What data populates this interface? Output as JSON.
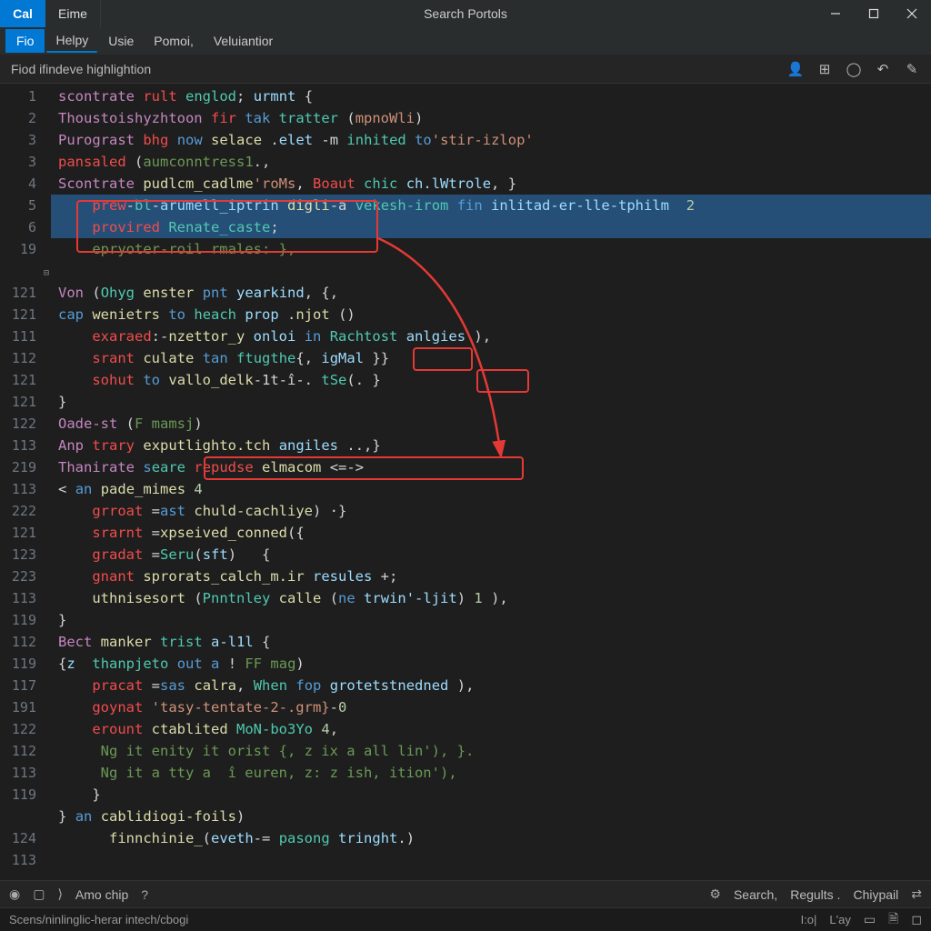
{
  "titlebar": {
    "app_badge": "Cal",
    "tab": "Eime",
    "title": "Search Portols"
  },
  "menubar": {
    "items": [
      "Fio",
      "Helpy",
      "Usie",
      "Pomoi,",
      "Veluiantior"
    ]
  },
  "subbar": {
    "label": "Fiod ifindeve highlightion"
  },
  "gutter_lines": [
    "1",
    "2",
    "3",
    "3",
    "4",
    "5",
    "6",
    "19",
    "",
    "121",
    "121",
    "111",
    "112",
    "121",
    "121",
    "122",
    "113",
    "219",
    "113",
    "222",
    "121",
    "123",
    "223",
    "113",
    "119",
    "112",
    "119",
    "117",
    "191",
    "122",
    "112",
    "113",
    "119",
    "",
    "124",
    "113"
  ],
  "code_lines": [
    {
      "cls": "",
      "html": "<span class='kw'>scontrate</span> <span class='err'>rult</span> <span class='ty'>englod</span><span class='op'>;</span> <span class='prop'>urmnt</span> <span class='op'>{</span>"
    },
    {
      "cls": "",
      "html": "<span class='kw'>Thoustoishyzhtoon</span> <span class='err'>fir</span> <span class='blue'>tak</span> <span class='ty'>tratter</span> <span class='op'>(</span><span class='str'>mpnoWli</span><span class='op'>)</span>"
    },
    {
      "cls": "",
      "html": "<span class='kw'>Purograst</span> <span class='err'>bhg</span> <span class='blue'>now</span> <span class='fn'>selace</span> <span class='op'>.</span><span class='prop'>elet</span> <span class='op'>-m</span> <span class='ty'>inhited</span> <span class='blue'>to</span><span class='str'>'stir-izlop'</span>"
    },
    {
      "cls": "",
      "html": "<span class='err'>pansaled</span> <span class='op'>(</span><span class='cm'>aumconntress1</span><span class='op'>.,</span>"
    },
    {
      "cls": "",
      "html": "<span class='kw'>Scontrate</span> <span class='fn'>pudlcm_cadlme</span><span class='str'>'roMs</span><span class='op'>,</span> <span class='err'>Boaut</span> <span class='ty'>chic</span> <span class='prop'>ch.lWtrole</span><span class='op'>, }</span>"
    },
    {
      "cls": "sel",
      "html": "    <span class='err'>prew</span><span class='op'>-</span><span class='ty'>bl</span><span class='op'>-</span><span class='prop'>arumell_iptrin</span> <span class='fn'>digli</span><span class='op'>-a</span> <span class='ty'>vekesh-irom</span> <span class='blue'>fin</span> <span class='prop'>inlitad-er-lle-tphilm</span>  <span class='num'>2</span>"
    },
    {
      "cls": "sel",
      "html": "    <span class='err'>provired</span> <span class='ty'>Renate_caste</span><span class='op'>;</span>"
    },
    {
      "cls": "",
      "html": "    <span class='cm'>epryoter-roil rmales: },</span>"
    },
    {
      "cls": "",
      "html": ""
    },
    {
      "cls": "",
      "html": "<span class='kw'>Von</span> <span class='op'>(</span><span class='ty'>Ohyg</span> <span class='fn'>enster</span> <span class='blue'>pnt</span> <span class='prop'>yearkind</span><span class='op'>, {,</span>"
    },
    {
      "cls": "",
      "html": "<span class='blue'>cap</span> <span class='fn'>wenietrs</span> <span class='blue'>to</span> <span class='ty'>heach</span> <span class='prop'>prop</span> <span class='op'>.</span><span class='fn'>njot</span> <span class='op'>()</span>"
    },
    {
      "cls": "",
      "html": "    <span class='err'>exaraed</span><span class='op'>:-</span><span class='fn'>nzettor_y</span> <span class='prop'>onloi</span> <span class='blue'>in</span> <span class='ty'>Rachtost</span> <span class='prop'>anlgies</span> <span class='op'>),</span>"
    },
    {
      "cls": "",
      "html": "    <span class='err'>srant</span> <span class='fn'>culate</span> <span class='blue'>tan</span> <span class='ty'>ftugthe</span><span class='op'>{,</span> <span class='prop'>igMal</span> <span class='op'>}}</span>"
    },
    {
      "cls": "",
      "html": "    <span class='err'>sohut</span> <span class='blue'>to</span> <span class='fn'>vallo_delk</span><span class='op'>-1t-î-.</span> <span class='ty'>tSe</span><span class='op'>(. }</span>"
    },
    {
      "cls": "",
      "html": "<span class='op'>}</span>"
    },
    {
      "cls": "",
      "html": "<span class='kw'>Oade-st</span> <span class='op'>(</span><span class='cm'>F mamsj</span><span class='op'>)</span>"
    },
    {
      "cls": "",
      "html": "<span class='kw'>Anp</span> <span class='err'>trary</span> <span class='fn'>exputlighto.tch</span> <span class='prop'>angiles</span> <span class='op'>..,}</span>"
    },
    {
      "cls": "",
      "html": "<span class='kw'>Thanirate</span> <span class='blue'>s</span><span class='ty'>eare</span> <span class='err'>repudse</span> <span class='fn'>elmacom</span> <span class='op'>&lt;=-&gt;</span>"
    },
    {
      "cls": "",
      "html": "<span class='op'>&lt;</span> <span class='blue'>an</span> <span class='fn'>pade_mimes</span> <span class='num'>4</span>"
    },
    {
      "cls": "",
      "html": "    <span class='err'>grroat</span> <span class='op'>=</span><span class='blue'>ast</span> <span class='fn'>chuld-cachliye</span><span class='op'>) ·}</span>"
    },
    {
      "cls": "",
      "html": "    <span class='err'>srarnt</span> <span class='op'>=</span><span class='fn'>xpseived_conned</span><span class='op'>({</span>"
    },
    {
      "cls": "",
      "html": "    <span class='err'>gradat</span> <span class='op'>=</span><span class='ty'>Seru</span><span class='op'>(</span><span class='prop'>sft</span><span class='op'>)   {</span>"
    },
    {
      "cls": "",
      "html": "    <span class='err'>gnant</span> <span class='fn'>sprorats_calch_m.ir</span> <span class='prop'>resules</span> <span class='op'>+;</span>"
    },
    {
      "cls": "",
      "html": "    <span class='fn'>uthnisesort</span> <span class='op'>(</span><span class='ty'>Pnntnley</span> <span class='fn'>calle</span> <span class='op'>(</span><span class='blue'>ne</span> <span class='prop'>trwin'-ljit</span><span class='op'>)</span> <span class='num'>1</span> <span class='op'>),</span>"
    },
    {
      "cls": "",
      "html": "<span class='op'>}</span>"
    },
    {
      "cls": "",
      "html": "<span class='kw'>Bect</span> <span class='fn'>manker</span> <span class='ty'>trist</span> <span class='prop'>a-l1l</span> <span class='op'>{</span>"
    },
    {
      "cls": "",
      "html": "<span class='op'>{</span><span class='prop'>z</span>  <span class='ty'>thanpjeto</span> <span class='blue'>out</span> <span class='blue'>a</span> <span class='op'>!</span> <span class='cm'>FF mag</span><span class='op'>)</span>"
    },
    {
      "cls": "",
      "html": "    <span class='err'>pracat</span> <span class='op'>=</span><span class='blue'>sas</span> <span class='fn'>calra</span><span class='op'>,</span> <span class='ty'>When</span> <span class='blue'>fop</span> <span class='prop'>grotetstnedned</span> <span class='op'>),</span>"
    },
    {
      "cls": "",
      "html": "    <span class='err'>goynat</span> <span class='str'>'tasy-tentate-2-.grm}</span><span class='op'>-</span><span class='num'>0</span>"
    },
    {
      "cls": "",
      "html": "    <span class='err'>erount</span> <span class='fn'>ctablited</span> <span class='ty'>MoN-bo3Yo</span> <span class='num'>4</span><span class='op'>,</span>"
    },
    {
      "cls": "",
      "html": "     <span class='cm'>Ng it enity it orist {, z ix a all lin'), }.</span>"
    },
    {
      "cls": "",
      "html": "     <span class='cm'>Ng it a tty a  î euren, z: z ish, ition'),</span>"
    },
    {
      "cls": "",
      "html": "    <span class='op'>}</span>"
    },
    {
      "cls": "",
      "html": "<span class='op'>}</span> <span class='blue'>an</span> <span class='fn'>cablidiogi-foils</span><span class='op'>)</span>"
    },
    {
      "cls": "",
      "html": "      <span class='fn'>finnchinie_</span><span class='op'>(</span><span class='prop'>eveth</span><span class='op'>-=</span> <span class='ty'>pasong</span> <span class='prop'>tringht</span><span class='op'>.)</span>"
    }
  ],
  "bottombar1": {
    "left_items": [
      "Amo chip",
      "?"
    ],
    "right_items": [
      "Search,",
      "Regults .",
      "Chiypail"
    ]
  },
  "statusbar": {
    "path": "Scens/ninlinglic-herar intech/cbogi",
    "right": [
      "I:o|",
      "L'ay"
    ]
  }
}
